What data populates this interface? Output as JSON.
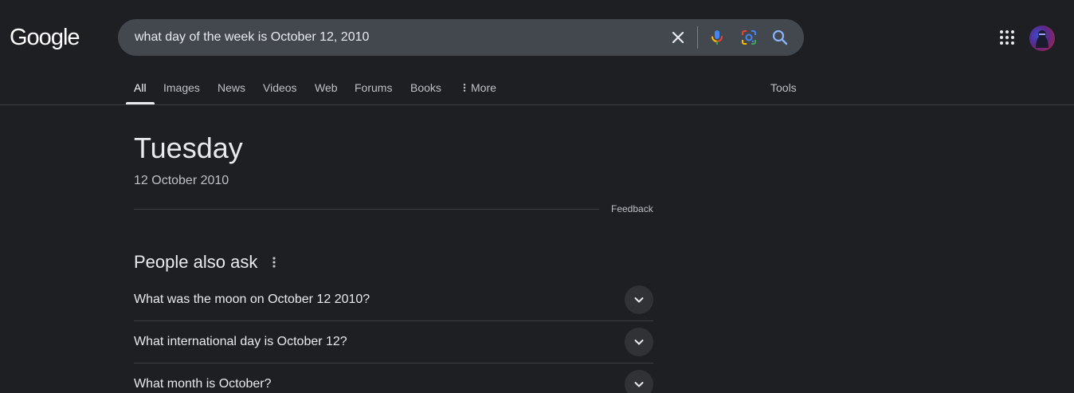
{
  "logo": {
    "text": "Google"
  },
  "search": {
    "query": "what day of the week is October 12, 2010",
    "icons": [
      "close-icon",
      "microphone-icon",
      "lens-icon",
      "search-icon"
    ]
  },
  "header": {
    "icons": [
      "apps-grid-icon",
      "avatar"
    ]
  },
  "tabs": [
    {
      "label": "All",
      "active": true
    },
    {
      "label": "Images"
    },
    {
      "label": "News"
    },
    {
      "label": "Videos"
    },
    {
      "label": "Web"
    },
    {
      "label": "Forums"
    },
    {
      "label": "Books"
    },
    {
      "label": "More"
    }
  ],
  "tools_label": "Tools",
  "answer": {
    "day": "Tuesday",
    "date": "12 October 2010",
    "feedback": "Feedback"
  },
  "people_also_ask": {
    "title": "People also ask",
    "questions": [
      "What was the moon on October 12 2010?",
      "What international day is October 12?",
      "What month is October?"
    ]
  },
  "colors": {
    "background": "#1f2023",
    "searchbox": "#43474e",
    "text_primary": "#e8eaed",
    "text_secondary": "#bdc1c6",
    "divider": "#3c4043"
  }
}
